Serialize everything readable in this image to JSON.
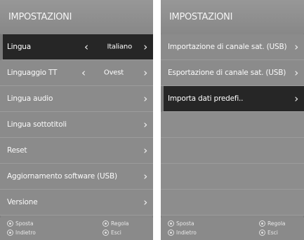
{
  "left_panel": {
    "title": "IMPOSTAZIONI",
    "items": [
      {
        "label": "Lingua",
        "value": "Italiano"
      },
      {
        "label": "Linguaggio TT",
        "value": "Ovest"
      },
      {
        "label": "Lingua audio"
      },
      {
        "label": "Lingua sottotitoli"
      },
      {
        "label": "Reset"
      },
      {
        "label": "Aggiornamento software (USB)"
      },
      {
        "label": "Versione"
      }
    ],
    "footer": {
      "move": "Sposta",
      "adjust": "Regola",
      "back": "Indietro",
      "exit": "Esci"
    }
  },
  "right_panel": {
    "title": "IMPOSTAZIONI",
    "items": [
      {
        "label": "Importazione di canale sat. (USB)"
      },
      {
        "label": "Esportazione di canale sat. (USB)"
      },
      {
        "label": "Importa dati predefi.."
      }
    ],
    "footer": {
      "move": "Sposta",
      "adjust": "Regola",
      "back": "Indietro",
      "exit": "Esci"
    }
  },
  "icons": {
    "arrow_right": "›",
    "arrow_left": "‹"
  }
}
